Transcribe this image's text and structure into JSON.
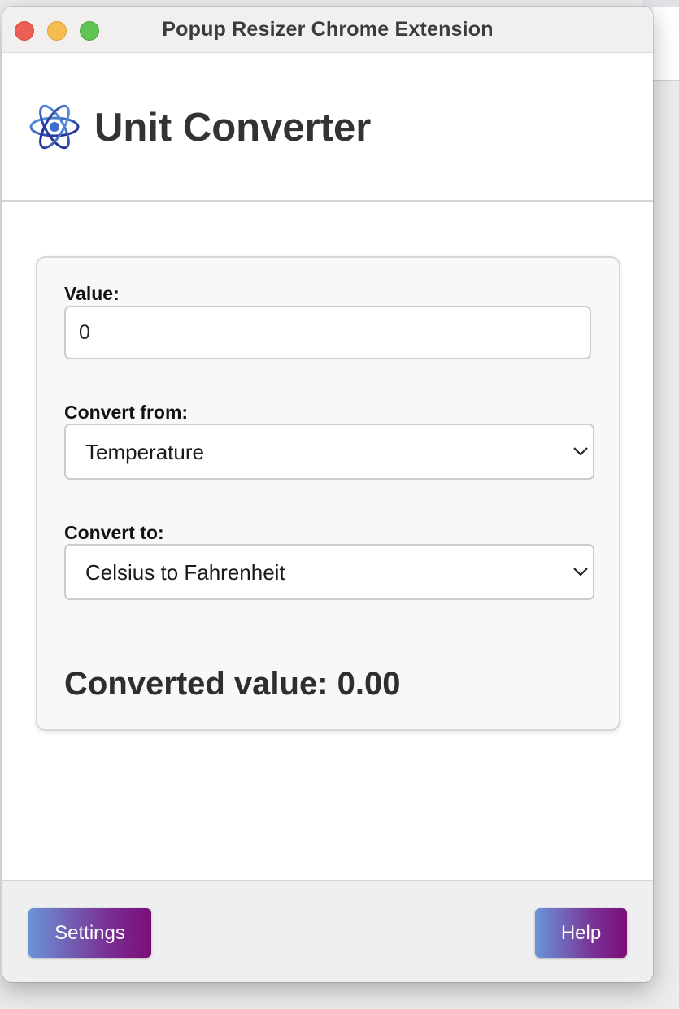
{
  "window": {
    "title": "Popup Resizer Chrome Extension"
  },
  "app": {
    "title": "Unit Converter",
    "logo_icon": "atom-icon"
  },
  "form": {
    "value_label": "Value:",
    "value": "0",
    "from_label": "Convert from:",
    "from_selected": "Temperature",
    "to_label": "Convert to:",
    "to_selected": "Celsius to Fahrenheit",
    "result_text": "Converted value: 0.00"
  },
  "footer": {
    "settings_label": "Settings",
    "help_label": "Help"
  },
  "colors": {
    "button_gradient_start": "#6a94d8",
    "button_gradient_end": "#7a0e78",
    "close": "#ec5f57",
    "minimize": "#f4bd4f",
    "maximize": "#5fc454"
  }
}
